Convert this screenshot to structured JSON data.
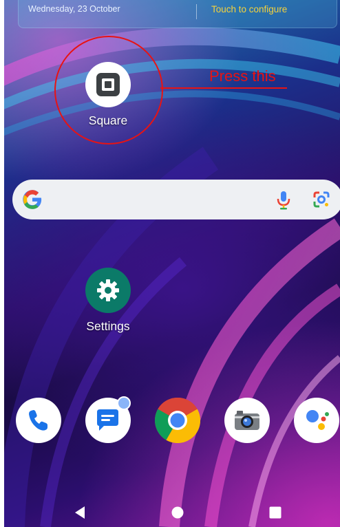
{
  "widget": {
    "date": "Wednesday, 23 October",
    "config_label": "Touch to configure"
  },
  "apps": {
    "square": {
      "label": "Square",
      "icon": "square-icon"
    },
    "settings": {
      "label": "Settings",
      "icon": "gear-icon"
    }
  },
  "annotation": {
    "text": "Press this",
    "color": "#e81313"
  },
  "search": {
    "icons": [
      "google-g-icon",
      "microphone-icon",
      "lens-icon"
    ]
  },
  "dock": {
    "icons": [
      "phone-icon",
      "messages-icon",
      "chrome-icon",
      "camera-icon",
      "assistant-icon"
    ]
  },
  "nav": {
    "icons": [
      "back-icon",
      "home-icon",
      "recents-icon"
    ]
  }
}
